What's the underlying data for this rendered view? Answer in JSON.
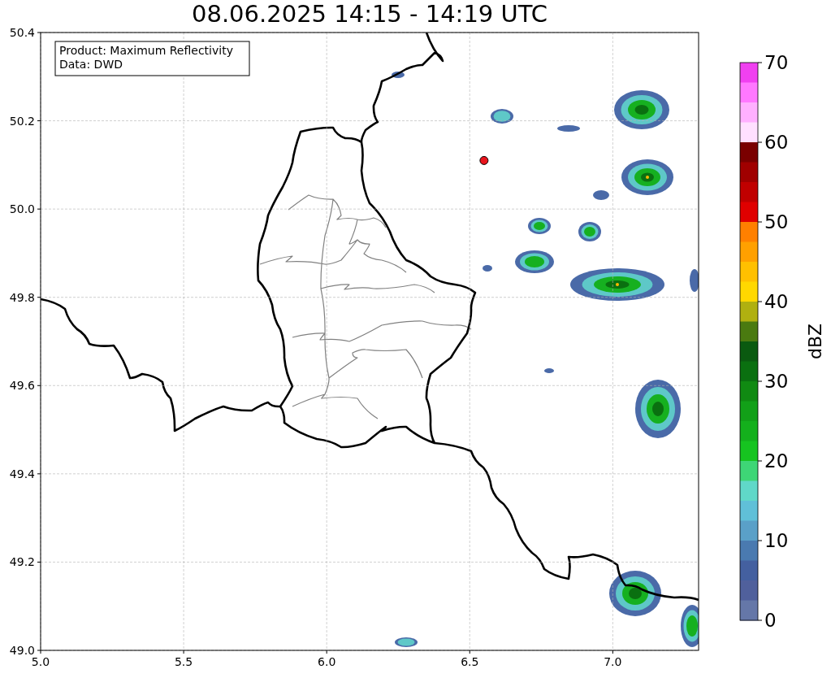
{
  "title": "08.06.2025 14:15 - 14:19 UTC",
  "annotation": {
    "lines": [
      "Product: Maximum Reflectivity",
      "Data: DWD"
    ]
  },
  "chart_data": {
    "type": "scatter",
    "grid": true,
    "xlim": [
      5.0,
      7.3
    ],
    "ylim": [
      49.0,
      50.4
    ],
    "xticks": [
      {
        "value": 5.0,
        "label": "5.0"
      },
      {
        "value": 5.5,
        "label": "5.5"
      },
      {
        "value": 6.0,
        "label": "6.0"
      },
      {
        "value": 6.5,
        "label": "6.5"
      },
      {
        "value": 7.0,
        "label": "7.0"
      }
    ],
    "yticks": [
      {
        "value": 50.4,
        "label": "50.4"
      },
      {
        "value": 50.2,
        "label": "50.2"
      },
      {
        "value": 50.0,
        "label": "50.0"
      },
      {
        "value": 49.8,
        "label": "49.8"
      },
      {
        "value": 49.6,
        "label": "49.6"
      },
      {
        "value": 49.4,
        "label": "49.4"
      },
      {
        "value": 49.2,
        "label": "49.2"
      },
      {
        "value": 49.0,
        "label": "49.0"
      }
    ],
    "x": [
      6.55
    ],
    "series": [
      {
        "color": "#e8141c",
        "values": [
          50.11
        ]
      }
    ]
  },
  "colorbar": {
    "label": "dBZ",
    "ticks": [
      "70",
      "60",
      "50",
      "40",
      "30",
      "20",
      "10",
      "0"
    ],
    "steps": [
      {
        "color": "#f040f0"
      },
      {
        "color": "#ff78ff"
      },
      {
        "color": "#ffb0ff"
      },
      {
        "color": "#ffe0ff"
      },
      {
        "color": "#7a0000"
      },
      {
        "color": "#a00000"
      },
      {
        "color": "#c00000"
      },
      {
        "color": "#e00000"
      },
      {
        "color": "#ff8000"
      },
      {
        "color": "#ffa000"
      },
      {
        "color": "#ffc000"
      },
      {
        "color": "#ffd800"
      },
      {
        "color": "#b0b010"
      },
      {
        "color": "#4a7a10"
      },
      {
        "color": "#0a5a10"
      },
      {
        "color": "#0a7010"
      },
      {
        "color": "#108a12"
      },
      {
        "color": "#12a018"
      },
      {
        "color": "#14b01c"
      },
      {
        "color": "#16c420"
      },
      {
        "color": "#3ed676"
      },
      {
        "color": "#60d8c8"
      },
      {
        "color": "#60c0d8"
      },
      {
        "color": "#5aa0c8"
      },
      {
        "color": "#4a7ab0"
      },
      {
        "color": "#4460a0"
      },
      {
        "color": "#50609c"
      },
      {
        "color": "#6577a8"
      }
    ]
  }
}
